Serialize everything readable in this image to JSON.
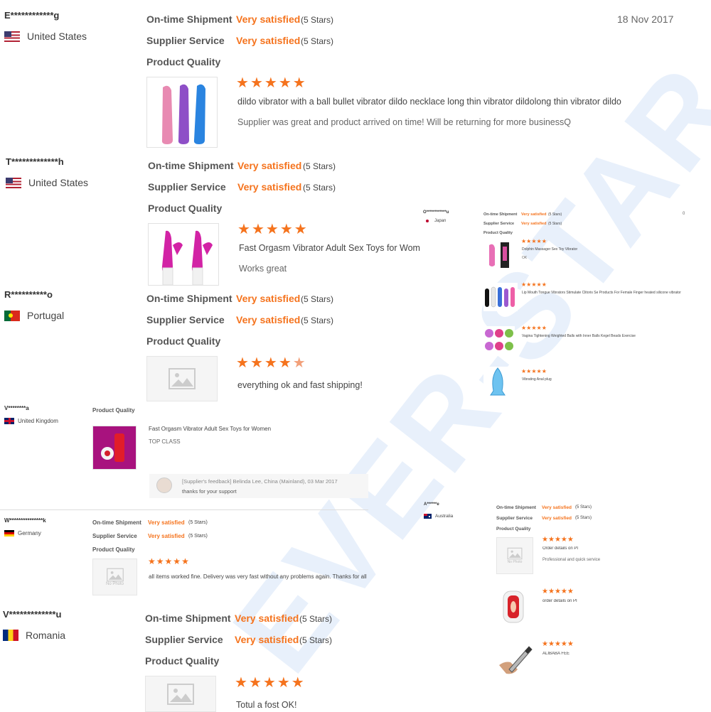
{
  "colors": {
    "accent": "#f5731d",
    "watermark": "#96b9eb"
  },
  "watermark": "EVER-STAR",
  "labels": {
    "shipment": "On-time Shipment",
    "service": "Supplier Service",
    "quality": "Product Quality",
    "satisfied": "Very satisfied",
    "five": "(5 Stars)",
    "no_photo": "No Photo"
  },
  "r1": {
    "name": "E************g",
    "country": "United States",
    "date": "18 Nov 2017",
    "rating": 5,
    "product": "dildo vibrator with a ball bullet vibrator dildo necklace long thin vibrator dildolong thin vibrator dildo",
    "comment": "Supplier was great and product arrived on time! Will be returning for more businessQ"
  },
  "r2": {
    "name": "T*************h",
    "country": "United States",
    "rating": 5,
    "product": "Fast Orgasm Vibrator Adult Sex Toys for Women",
    "comment": "Works great"
  },
  "r3": {
    "name": "R**********o",
    "country": "Portugal",
    "rating": 4,
    "comment": "everything ok and fast shipping!"
  },
  "r4": {
    "name": "V********a",
    "country": "United Kingdom",
    "product": "Fast Orgasm Vibrator Adult Sex Toys for Women",
    "comment": "TOP CLASS",
    "feedback_header": "[Supplier's feedback] Belinda Lee, China (Mainland), 03 Mar 2017",
    "feedback_text": "thanks for your support"
  },
  "r5": {
    "name": "W***************k",
    "country": "Germany",
    "rating": 5,
    "comment": "all items worked fine. Delivery was very fast without any problems again. Thanks for all"
  },
  "r6": {
    "name": "V*************u",
    "country": "Romania",
    "rating": 5,
    "comment": "Totul a fost OK!"
  },
  "rj": {
    "name": "O************u",
    "country": "Japan",
    "date": "0",
    "items": [
      {
        "rating": 5,
        "product": "Dolphin Massager Sex Toy Vibrator",
        "comment": "OK"
      },
      {
        "rating": 5,
        "product": "Lip Mouth Tongue Vibrators Stimulate Clitoris Se Products For Female Finger heated silicone vibrator"
      },
      {
        "rating": 5,
        "product": "Vagina Tightening Weighted Balls with Inner Balls Kegel Beads Exercise"
      },
      {
        "rating": 5,
        "product": "Vibrating Anal plug"
      }
    ]
  },
  "ra": {
    "name": "A******e",
    "country": "Australia",
    "items": [
      {
        "rating": 5,
        "product": "Order details on PI",
        "comment": "Professional and quick service"
      },
      {
        "rating": 5,
        "product": "order details on PI"
      },
      {
        "rating": 5,
        "product": "ALIBABA FEE"
      }
    ]
  }
}
